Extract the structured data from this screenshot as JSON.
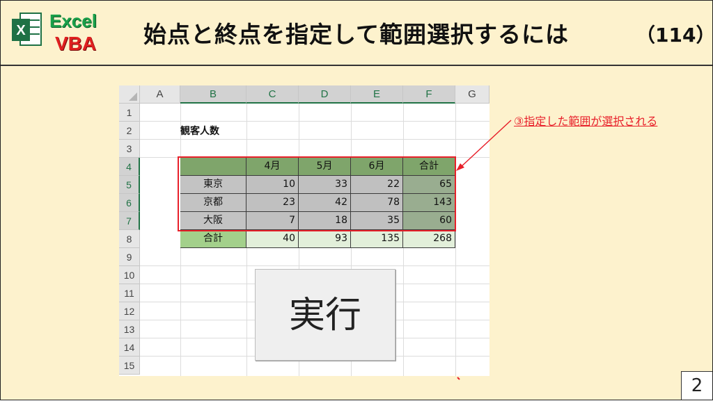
{
  "header": {
    "logo_word1": "Excel",
    "logo_word2": "VBA",
    "title": "始点と終点を指定して範囲選択するには",
    "lesson_number": "（114）"
  },
  "page_number": "2",
  "annotation": "③指定した範囲が選択される",
  "sheet": {
    "columns": [
      "A",
      "B",
      "C",
      "D",
      "E",
      "F",
      "G"
    ],
    "rows": [
      "1",
      "2",
      "3",
      "4",
      "5",
      "6",
      "7",
      "8",
      "9",
      "10",
      "11",
      "12",
      "13",
      "14",
      "15"
    ],
    "caption": "観客人数",
    "table": {
      "headers": [
        "",
        "4月",
        "5月",
        "6月",
        "合計"
      ],
      "body": [
        [
          "東京",
          "10",
          "33",
          "22",
          "65"
        ],
        [
          "京都",
          "23",
          "42",
          "78",
          "143"
        ],
        [
          "大阪",
          "7",
          "18",
          "35",
          "60"
        ],
        [
          "合計",
          "40",
          "93",
          "135",
          "268"
        ]
      ]
    },
    "button_label": "実行"
  },
  "colors": {
    "excel_green": "#217346",
    "annotation_red": "#e8202a",
    "slide_bg": "#fdf2cd"
  }
}
